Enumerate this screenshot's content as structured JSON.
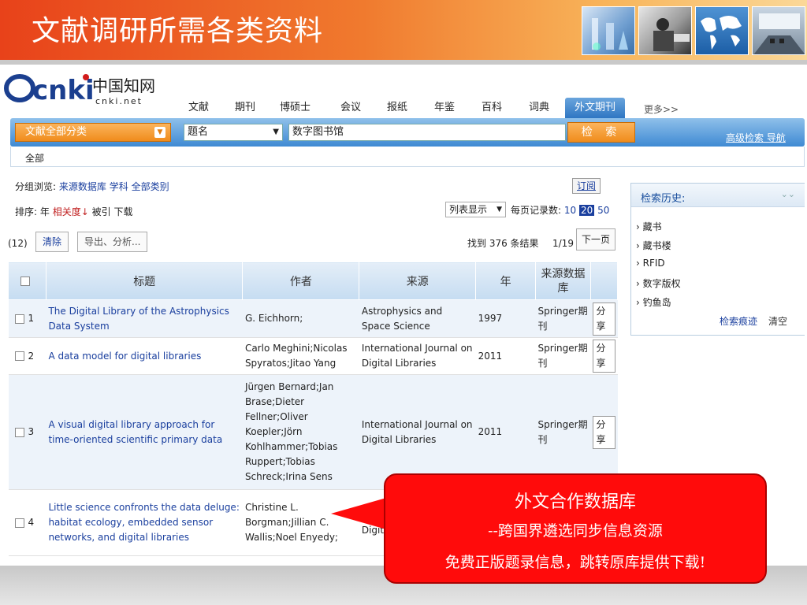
{
  "slide": {
    "title": "文献调研所需各类资料"
  },
  "logo": {
    "text": "cnki",
    "subtitle": "中国知网",
    "domain": "cnki.net"
  },
  "nav": {
    "tabs": [
      "文献",
      "期刊",
      "博硕士",
      "会议",
      "报纸",
      "年鉴",
      "百科",
      "词典",
      "外文期刊"
    ],
    "active": "外文期刊",
    "more": "更多>>"
  },
  "search": {
    "category": "文献全部分类",
    "field": "题名",
    "query": "数字图书馆",
    "button": "检  索",
    "advanced": "高级检索 导航"
  },
  "scope": "全部",
  "group": {
    "label": "分组浏览:",
    "items": [
      "来源数据库",
      "学科",
      "全部类别"
    ],
    "subscribe": "订阅"
  },
  "sort": {
    "label": "排序:",
    "items": [
      "年",
      "相关度↓",
      "被引",
      "下载"
    ],
    "view": "列表显示",
    "perpage_label": "每页记录数:",
    "perpage_options": [
      "10",
      "20",
      "50"
    ],
    "perpage_selected": "20"
  },
  "actions": {
    "count": "(12)",
    "clear": "清除",
    "export": "导出、分析..."
  },
  "paging": {
    "found": "找到 376 条结果",
    "page": "1/19",
    "next": "下一页"
  },
  "table": {
    "headers": {
      "title": "标题",
      "author": "作者",
      "source": "来源",
      "year": "年",
      "db": "来源数据库"
    },
    "rows": [
      {
        "num": "1",
        "title": "The Digital Library of the Astrophysics Data System",
        "author": "G. Eichhorn;",
        "source": "Astrophysics and Space Science",
        "year": "1997",
        "db": "Springer期刊",
        "share": "分享"
      },
      {
        "num": "2",
        "title": "A data model for digital libraries",
        "author": "Carlo Meghini;Nicolas Spyratos;Jitao Yang",
        "source": "International Journal on Digital Libraries",
        "year": "2011",
        "db": "Springer期刊",
        "share": "分享"
      },
      {
        "num": "3",
        "title": "A visual digital library approach for time-oriented scientific primary data",
        "author": "Jürgen Bernard;Jan Brase;Dieter Fellner;Oliver Koepler;Jörn Kohlhammer;Tobias Ruppert;Tobias Schreck;Irina Sens",
        "source": "International Journal on Digital Libraries",
        "year": "2011",
        "db": "Springer期刊",
        "share": "分享"
      },
      {
        "num": "4",
        "title": "Little science confronts the data deluge: habitat ecology, embedded sensor networks, and digital libraries",
        "author": "Christine L. Borgman;Jillian C. Wallis;Noel Enyedy;",
        "source": "International Journal on Digital Libraries",
        "year": "",
        "db": "",
        "share": ""
      }
    ]
  },
  "history": {
    "title": "检索历史:",
    "items": [
      "藏书",
      "藏书楼",
      "RFID",
      "数字版权",
      "钓鱼岛"
    ],
    "trace": "检索痕迹",
    "clear": "清空"
  },
  "callout": {
    "line1": "外文合作数据库",
    "line2": "--跨国界遴选同步信息资源",
    "line3": "免费正版题录信息，跳转原库提供下载!"
  }
}
